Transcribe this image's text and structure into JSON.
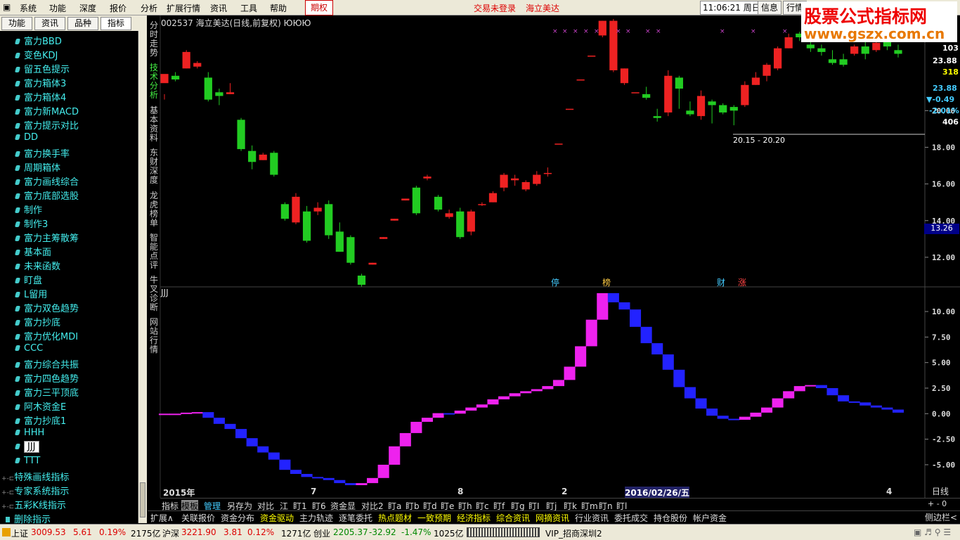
{
  "menubar": {
    "items": [
      "系统",
      "功能",
      "深度",
      "报价",
      "分析",
      "扩展行情",
      "资讯",
      "工具",
      "帮助"
    ],
    "options": "期权",
    "login_text": "交易未登录",
    "stock_name_top": "海立美达",
    "clock": "11:06:21",
    "weekday": "周日",
    "btn_info": "信息",
    "btn_quote": "行情"
  },
  "brand": {
    "title": "股票公式指标网",
    "url": "www.gszx.com.cn"
  },
  "sidebar": {
    "tabs": [
      "功能",
      "资讯",
      "品种",
      "指标"
    ],
    "items": [
      "富力BBD",
      "变色KDJ",
      "留五色提示",
      "富力箱体3",
      "富力箱体4",
      "富力新MACD",
      "富力提示对比",
      "DD",
      "富力换手率",
      "周期箱体",
      "富力画线综合",
      "富力底部选股",
      "制作",
      "制作3",
      "富力主筹散筹",
      "基本面",
      "未来函数",
      "盯盘",
      "L留用",
      "富力双色趋势",
      "富力抄底",
      "富力优化MDI",
      "CCC",
      "富力综合共振",
      "富力四色趋势",
      "富力三平顶底",
      "阿木资金E",
      "富力抄底1",
      "HHH",
      "JJJ",
      "TTT"
    ],
    "selected_index": 29,
    "groups": [
      "特殊画线指标",
      "专家系统指示",
      "五彩K线指示",
      "删除指示"
    ]
  },
  "vtabs": [
    "分时走势",
    "技术分析",
    "基本资料",
    "东财深度",
    "龙虎榜单",
    "智能点评",
    "牛叉诊断",
    "网站行情"
  ],
  "main": {
    "title": "002537 海立美达(日线,前复权) ЮЮЮ",
    "indicator_name": "JJJ",
    "price_range_label": "20.15 - 20.20",
    "markers": [
      {
        "text": "停",
        "color": "#4cf"
      },
      {
        "text": "榜",
        "color": "#fc4"
      },
      {
        "text": "财",
        "color": "#4cf"
      },
      {
        "text": "涨",
        "color": "#f44"
      }
    ],
    "right_labels": {
      "v103": "103",
      "v2388": "23.88",
      "v318": "318",
      "v2388b": "23.88",
      "chg": "▼-0.49",
      "pct": "-2.01%",
      "v406": "406",
      "cur": "13.26"
    },
    "date_labels": [
      "2015年",
      "7",
      "8",
      "2",
      "2016/02/26/五",
      "4"
    ],
    "period": "日线"
  },
  "chart_data": {
    "type": "candlestick",
    "price_axis": {
      "ticks": [
        12.0,
        14.0,
        16.0,
        18.0,
        20.0
      ],
      "labels": [
        "12.00",
        "14.00",
        "16.00",
        "18.00",
        "20.00"
      ],
      "range": [
        10.5,
        24.5
      ]
    },
    "indicator_axis": {
      "ticks": [
        10.0,
        7.5,
        5.0,
        2.5,
        0.0,
        -2.5,
        -5.0
      ],
      "labels": [
        "10.00",
        "7.50",
        "5.00",
        "2.50",
        "0.00",
        "-2.50",
        "-5.00"
      ],
      "range": [
        -7.0,
        12.0
      ]
    },
    "candles": [
      [
        21.5,
        22.0,
        20.9,
        20.6
      ],
      [
        21.9,
        21.7,
        22.1,
        21.6
      ],
      [
        22.3,
        23.2,
        23.3,
        22.3
      ],
      [
        22.4,
        22.6,
        22.7,
        22.3
      ],
      [
        21.8,
        20.6,
        22.1,
        20.5
      ],
      [
        21.0,
        20.8,
        21.2,
        20.3
      ],
      [
        20.9,
        21.0,
        21.5,
        20.9
      ],
      [
        19.5,
        17.9,
        19.6,
        17.8
      ],
      [
        17.8,
        17.2,
        18.1,
        16.8
      ],
      [
        17.3,
        17.6,
        17.7,
        17.3
      ],
      [
        17.7,
        16.5,
        17.8,
        16.4
      ],
      [
        14.9,
        14.1,
        15.0,
        14.0
      ],
      [
        13.9,
        15.3,
        15.5,
        13.8
      ],
      [
        14.5,
        12.9,
        14.8,
        12.8
      ],
      [
        14.5,
        14.7,
        15.0,
        14.3
      ],
      [
        14.9,
        13.2,
        15.1,
        13.0
      ],
      [
        13.4,
        12.3,
        13.9,
        12.3
      ],
      [
        13.1,
        11.7,
        13.2,
        11.6
      ],
      [
        11.0,
        10.5,
        11.1,
        10.4
      ],
      [
        11.6,
        11.7,
        11.7,
        11.6
      ],
      [
        13.0,
        13.1,
        13.1,
        13.0
      ],
      [
        14.0,
        14.1,
        14.1,
        14.0
      ],
      [
        15.1,
        15.2,
        15.2,
        15.1
      ],
      [
        15.8,
        14.4,
        15.9,
        14.3
      ],
      [
        16.3,
        16.4,
        16.5,
        16.2
      ],
      [
        15.3,
        14.6,
        15.4,
        14.5
      ],
      [
        14.2,
        14.4,
        14.6,
        14.1
      ],
      [
        14.5,
        13.1,
        14.7,
        13.0
      ],
      [
        13.4,
        14.5,
        14.6,
        13.2
      ],
      [
        14.9,
        14.9,
        15.0,
        14.8
      ],
      [
        15.0,
        15.5,
        15.6,
        15.0
      ],
      [
        15.8,
        16.5,
        16.6,
        15.6
      ],
      [
        16.2,
        16.3,
        16.5,
        15.9
      ],
      [
        15.7,
        16.1,
        16.2,
        15.6
      ],
      [
        16.0,
        16.5,
        16.7,
        15.9
      ],
      [
        16.6,
        16.6,
        16.9,
        16.4
      ],
      [
        18.2,
        18.2,
        18.2,
        18.2
      ],
      [
        20.1,
        20.1,
        20.1,
        20.1
      ],
      [
        21.7,
        21.7,
        21.7,
        21.7
      ],
      [
        23.0,
        23.0,
        23.0,
        23.0
      ],
      [
        24.1,
        24.9,
        24.9,
        24.0
      ],
      [
        22.2,
        24.9,
        25.0,
        22.1
      ],
      [
        21.5,
        22.3,
        22.3,
        21.4
      ],
      [
        21.0,
        21.0,
        21.0,
        21.0
      ],
      [
        20.9,
        20.7,
        21.3,
        20.6
      ],
      [
        19.7,
        19.6,
        20.1,
        19.4
      ],
      [
        19.9,
        21.9,
        22.2,
        19.7
      ],
      [
        21.8,
        21.2,
        21.9,
        20.1
      ],
      [
        20.0,
        19.8,
        20.5,
        19.7
      ],
      [
        19.7,
        20.8,
        21.1,
        19.5
      ],
      [
        20.5,
        20.3,
        20.6,
        19.3
      ],
      [
        20.3,
        19.9,
        20.4,
        19.8
      ],
      [
        20.2,
        20.0,
        20.3,
        19.2
      ],
      [
        20.3,
        21.4,
        21.6,
        20.2
      ],
      [
        21.4,
        21.8,
        22.1,
        21.4
      ],
      [
        21.9,
        22.5,
        22.6,
        21.6
      ],
      [
        22.3,
        23.4,
        23.5,
        22.2
      ],
      [
        23.4,
        24.0,
        24.2,
        23.4
      ],
      [
        24.2,
        24.0,
        24.3,
        23.8
      ],
      [
        23.6,
        23.4,
        23.8,
        23.2
      ],
      [
        23.4,
        23.2,
        23.6,
        23.0
      ],
      [
        22.8,
        22.6,
        23.3,
        22.5
      ],
      [
        22.8,
        22.5,
        23.1,
        22.4
      ],
      [
        23.1,
        23.5,
        23.6,
        23.0
      ],
      [
        23.5,
        23.1,
        24.2,
        22.8
      ],
      [
        23.3,
        23.7,
        24.0,
        23.2
      ],
      [
        23.8,
        23.5,
        24.0,
        23.3
      ],
      [
        23.3,
        23.1,
        23.6,
        22.9
      ]
    ],
    "indicator_values": [
      0.0,
      0.0,
      0.1,
      0.15,
      -0.4,
      -1.0,
      -1.5,
      -2.4,
      -3.2,
      -3.8,
      -4.5,
      -5.5,
      -5.9,
      -6.2,
      -6.3,
      -6.5,
      -6.8,
      -7.0,
      -6.8,
      -6.3,
      -5.0,
      -3.2,
      -1.9,
      -0.8,
      -0.4,
      0.05,
      0.0,
      0.3,
      0.6,
      0.9,
      1.4,
      1.7,
      2.0,
      2.2,
      2.4,
      2.7,
      3.3,
      4.6,
      6.6,
      9.2,
      11.8,
      10.9,
      10.2,
      8.5,
      6.9,
      5.8,
      4.3,
      2.6,
      1.5,
      0.5,
      -0.2,
      -0.5,
      -0.6,
      -0.3,
      0.1,
      0.6,
      1.5,
      2.2,
      2.7,
      2.8,
      2.5,
      1.8,
      1.2,
      1.1,
      0.8,
      0.6,
      0.4,
      0.1
    ]
  },
  "bottom_tabs": [
    "指标",
    "模板",
    "管理",
    "另存为",
    "对比",
    "江",
    "盯1",
    "盯6",
    "资金显",
    "对比2",
    "盯a",
    "盯b",
    "盯d",
    "盯e",
    "盯h",
    "盯c",
    "盯f",
    "盯g",
    "盯I",
    "盯j",
    "盯k",
    "盯m",
    "盯n",
    "盯l"
  ],
  "link_tabs": [
    "扩展∧",
    "关联报价",
    "资金分布",
    "资金驱动",
    "主力轨迹",
    "逐笔委托",
    "热点题材",
    "一致预期",
    "经济指标",
    "综合资讯",
    "网摘资讯",
    "行业资讯",
    "委托成交",
    "持仓股份",
    "帐户资金"
  ],
  "right_extra": {
    "sidebar_toggle": "侧边栏<",
    "zoom": "+ - 0"
  },
  "status": {
    "sh_label": "上证",
    "sh_val": "3009.53",
    "sh_chg": "5.61",
    "sh_pct": "0.19%",
    "sh_amt": "2175亿",
    "sz_label": "沪深",
    "sz_val": "3221.90",
    "sz_chg": "3.81",
    "sz_pct": "0.12%",
    "sz_amt": "1271亿",
    "cy_label": "创业",
    "cy_val": "2205.37",
    "cy_chg": "-32.92",
    "cy_pct": "-1.47%",
    "cy_amt": "1025亿",
    "vip": "VIP_招商深圳2"
  }
}
